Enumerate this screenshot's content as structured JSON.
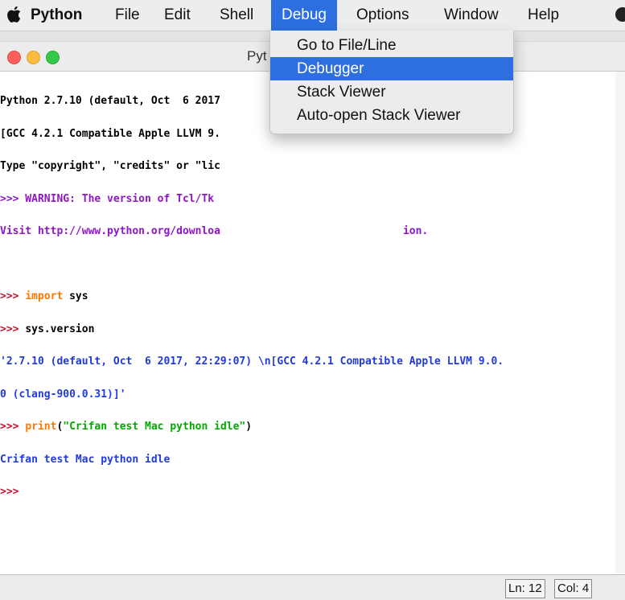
{
  "menubar": {
    "icons": [
      "apple-icon",
      "control-center-icon"
    ],
    "items": [
      {
        "label": "Python"
      },
      {
        "label": "File"
      },
      {
        "label": "Edit"
      },
      {
        "label": "Shell"
      },
      {
        "label": "Debug"
      },
      {
        "label": "Options"
      },
      {
        "label": "Window"
      },
      {
        "label": "Help"
      }
    ]
  },
  "window": {
    "title": "Pyt"
  },
  "debug_menu": {
    "items": [
      {
        "label": "Go to File/Line"
      },
      {
        "label": "Debugger"
      },
      {
        "label": "Stack Viewer"
      },
      {
        "label": "Auto-open Stack Viewer"
      }
    ]
  },
  "shell": {
    "banner": [
      "Python 2.7.10 (default, Oct  6 2017",
      "[GCC 4.2.1 Compatible Apple LLVM 9.",
      "Type \"copyright\", \"credits\" or \"lic",
      ">>> WARNING: The version of Tcl/Tk",
      "Visit http://www.python.org/downloa"
    ],
    "banner_tail": "ion.",
    "prompt": ">>> ",
    "import_keyword": "import",
    "import_rest": " sys",
    "cmd2": "sys.version",
    "version_output_1": "'2.7.10 (default, Oct  6 2017, 22:29:07) \\n[GCC 4.2.1 Compatible Apple LLVM 9.0.",
    "version_output_2": "0 (clang-900.0.31)]'",
    "print_keyword": "print",
    "print_open": "(",
    "print_string": "\"Crifan test Mac python idle\"",
    "print_close": ")",
    "print_output": "Crifan test Mac python idle",
    "final_prompt": ">>>"
  },
  "statusbar": {
    "line": "Ln: 12",
    "col": "Col: 4"
  },
  "colors": {
    "menu_highlight": "#2d6fe0",
    "prompt_red": "#c8102e",
    "output_blue": "#1f3adf",
    "keyword_orange": "#ff7700",
    "string_green": "#00aa00"
  }
}
